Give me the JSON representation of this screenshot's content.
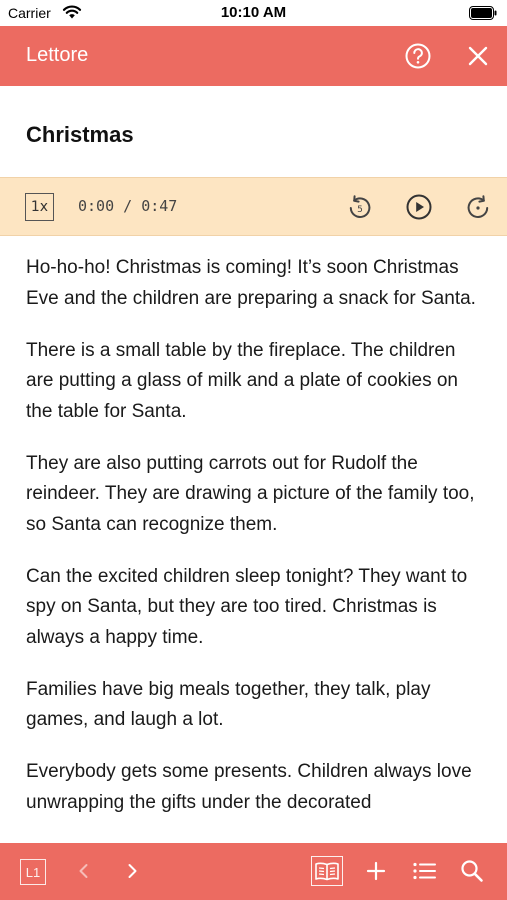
{
  "status_bar": {
    "carrier": "Carrier",
    "time": "10:10 AM"
  },
  "header": {
    "title": "Lettore",
    "help_icon": "help-circle-icon",
    "close_icon": "close-icon"
  },
  "story": {
    "title": "Christmas",
    "paragraphs": [
      "Ho-ho-ho! Christmas is coming! It’s soon Christmas Eve and the children are preparing a snack for Santa.",
      "There is a small table by the fireplace. The children are putting a glass of milk and a plate of cookies on the table for Santa.",
      "They are also putting carrots out for Rudolf the reindeer. They are drawing a picture of the family too, so Santa can recognize them.",
      "Can the excited children sleep tonight? They want to spy on Santa, but they are too tired. Christmas is always a happy time.",
      "Families have big meals together, they talk, play games, and laugh a lot.",
      "Everybody gets some presents. Children always love unwrapping the gifts under the decorated"
    ]
  },
  "player": {
    "speed": "1x",
    "time": "0:00 / 0:47",
    "rewind_label": "5"
  },
  "toolbar": {
    "level": "L1",
    "icons": [
      "chevron-left-icon",
      "chevron-right-icon",
      "book-icon",
      "plus-icon",
      "list-icon",
      "search-icon"
    ]
  },
  "colors": {
    "accent": "#ec6b61",
    "player_bg": "#fde5c2"
  }
}
